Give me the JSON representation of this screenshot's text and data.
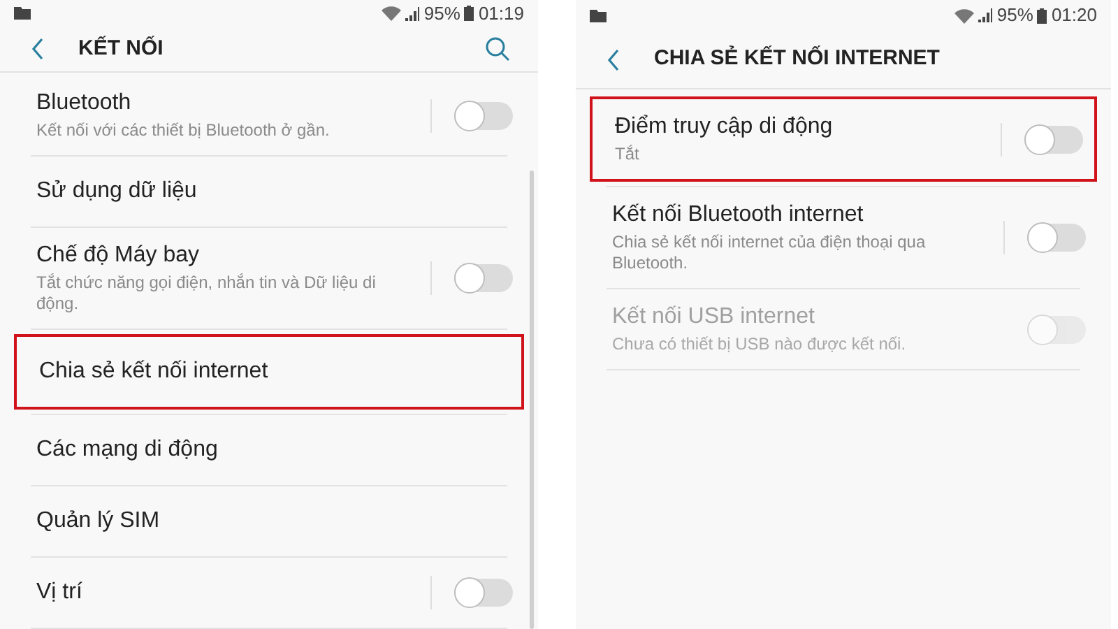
{
  "screens": [
    {
      "status": {
        "battery": "95%",
        "time": "01:19"
      },
      "header": {
        "title": "KẾT NỐI",
        "search": true
      },
      "scrollable": true,
      "items": [
        {
          "kind": "toggle",
          "title": "Bluetooth",
          "subtitle": "Kết nối với các thiết bị Bluetooth ở gần.",
          "on": false,
          "disabled": false,
          "highlighted": false
        },
        {
          "kind": "plain",
          "title": "Sử dụng dữ liệu",
          "disabled": false,
          "highlighted": false
        },
        {
          "kind": "toggle",
          "title": "Chế độ Máy bay",
          "subtitle": "Tắt chức năng gọi điện, nhắn tin và Dữ liệu di động.",
          "on": false,
          "disabled": false,
          "highlighted": false
        },
        {
          "kind": "plain",
          "title": "Chia sẻ kết nối internet",
          "disabled": false,
          "highlighted": true
        },
        {
          "kind": "plain",
          "title": "Các mạng di động",
          "disabled": false,
          "highlighted": false
        },
        {
          "kind": "plain",
          "title": "Quản lý SIM",
          "disabled": false,
          "highlighted": false
        },
        {
          "kind": "toggle",
          "title": "Vị trí",
          "on": false,
          "disabled": false,
          "highlighted": false
        }
      ]
    },
    {
      "status": {
        "battery": "95%",
        "time": "01:20"
      },
      "header": {
        "title": "CHIA SẺ KẾT NỐI INTERNET",
        "search": false
      },
      "scrollable": false,
      "items": [
        {
          "kind": "toggle",
          "title": "Điểm truy cập di động",
          "subtitle": "Tắt",
          "on": false,
          "disabled": false,
          "highlighted": true
        },
        {
          "kind": "toggle",
          "title": "Kết nối Bluetooth internet",
          "subtitle": "Chia sẻ kết nối internet của điện thoại qua Bluetooth.",
          "on": false,
          "disabled": false,
          "highlighted": false
        },
        {
          "kind": "toggle",
          "title": "Kết nối USB internet",
          "subtitle": "Chưa có thiết bị USB nào được kết nối.",
          "on": false,
          "disabled": true,
          "highlighted": false
        }
      ]
    }
  ]
}
